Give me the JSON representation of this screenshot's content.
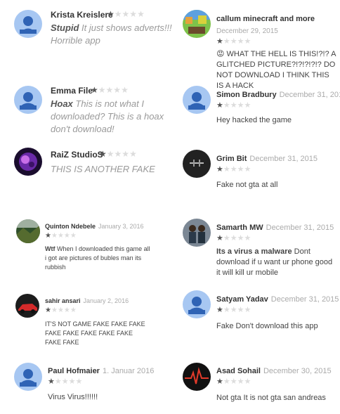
{
  "reviews": [
    {
      "id": "krista",
      "name": "Krista Kreislere",
      "date": "",
      "rating": 1,
      "lead": "Stupid",
      "text": " It just shows adverts!!! Horrible app",
      "avatar": "default-avatar-icon"
    },
    {
      "id": "callum",
      "name": "callum minecraft and more",
      "date": "December 29, 2015",
      "rating": 1,
      "lead": "",
      "text": "😡 WHAT THE HELL IS THIS!?!? A GLITCHED PICTURE?!?!?!?!? DO NOT DOWNLOAD I THINK THIS IS A HACK",
      "avatar": "minecraft-avatar-icon"
    },
    {
      "id": "emma",
      "name": "Emma File",
      "date": "",
      "rating": 1,
      "lead": "Hoax",
      "text": " This is not what I downloaded? This is a hoax don't download!",
      "avatar": "default-avatar-icon"
    },
    {
      "id": "simon",
      "name": "Simon Bradbury",
      "date": "December 31, 2015",
      "rating": 1,
      "lead": "",
      "text": "Hey hacked the game",
      "avatar": "default-avatar-icon"
    },
    {
      "id": "raiz",
      "name": "RaiZ StudioS",
      "date": "",
      "rating": 1,
      "lead": "",
      "text": "THIS IS ANOTHER FAKE",
      "avatar": "purple-art-avatar-icon"
    },
    {
      "id": "grim",
      "name": "Grim Bit",
      "date": "December 31, 2015",
      "rating": 1,
      "lead": "",
      "text": "Fake not gta at all",
      "avatar": "dark-avatar-icon"
    },
    {
      "id": "quinton",
      "name": "Quinton Ndebele",
      "date": "January 3, 2016",
      "rating": 1,
      "lead": "Wtf",
      "text": " When I downloaded this game all i got are pictures of bubles man its rubbish",
      "avatar": "landscape-avatar-icon"
    },
    {
      "id": "samarth",
      "name": "Samarth MW",
      "date": "December 31, 2015",
      "rating": 1,
      "lead": "Its a virus a malware",
      "text": " Dont download if u want ur phone good it will kill ur mobile",
      "avatar": "people-photo-avatar-icon"
    },
    {
      "id": "sahir",
      "name": "sahir ansari",
      "date": "January 2, 2016",
      "rating": 1,
      "lead": "",
      "text": "IT'S NOT GAME FAKE FAKE FAKE FAKE FAKE FAKE FAKE FAKE FAKE FAKE",
      "avatar": "car-avatar-icon"
    },
    {
      "id": "satyam",
      "name": "Satyam Yadav",
      "date": "December 31, 2015",
      "rating": 1,
      "lead": "",
      "text": "Fake Don't download this app",
      "avatar": "default-avatar-icon"
    },
    {
      "id": "paul",
      "name": "Paul Hofmaier",
      "date": "1. Januar 2016",
      "rating": 1,
      "lead": "",
      "text": "Virus Virus!!!!!!",
      "avatar": "default-avatar-icon"
    },
    {
      "id": "asad",
      "name": "Asad Sohail",
      "date": "December 30, 2015",
      "rating": 1,
      "lead": "",
      "text": "Not gta It is not gta san andreas",
      "avatar": "heartbeat-avatar-icon"
    }
  ],
  "star_glyph": "★",
  "colors": {
    "star_on": "#555555",
    "star_off": "#dcdcdc",
    "avatar_default": "#a7c7f2",
    "date": "#aaaaaa"
  }
}
